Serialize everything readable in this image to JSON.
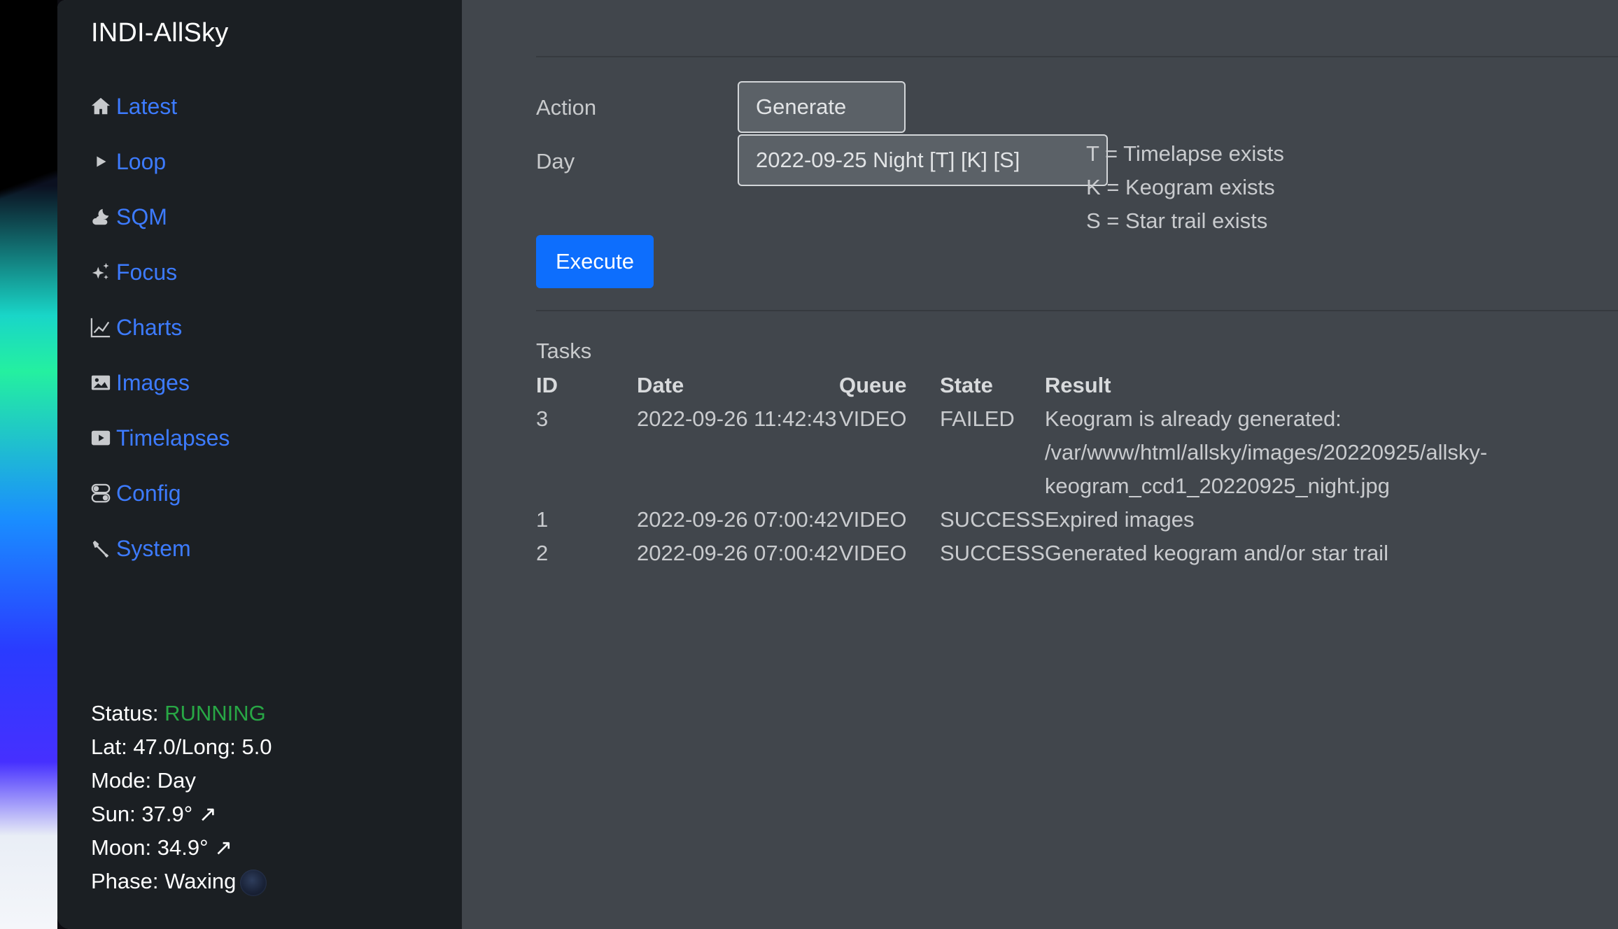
{
  "app": {
    "title": "INDI-AllSky"
  },
  "sidebar": {
    "items": [
      {
        "label": "Latest",
        "icon": "house-icon"
      },
      {
        "label": "Loop",
        "icon": "play-icon"
      },
      {
        "label": "SQM",
        "icon": "cloud-moon-icon"
      },
      {
        "label": "Focus",
        "icon": "sparkles-icon"
      },
      {
        "label": "Charts",
        "icon": "graph-icon"
      },
      {
        "label": "Images",
        "icon": "image-icon"
      },
      {
        "label": "Timelapses",
        "icon": "video-play-icon"
      },
      {
        "label": "Config",
        "icon": "toggles-icon"
      },
      {
        "label": "System",
        "icon": "wrench-icon"
      }
    ],
    "status": {
      "status_label": "Status: ",
      "status_value": "RUNNING",
      "latlong": "Lat: 47.0/Long: 5.0",
      "mode": "Mode: Day",
      "sun": "Sun: 37.9° ↗",
      "moon": "Moon: 34.9° ↗",
      "phase": "Phase: Waxing"
    }
  },
  "form": {
    "action_label": "Action",
    "action_value": "Generate",
    "day_label": "Day",
    "day_value": "2022-09-25 Night [T] [K] [S]",
    "legend": [
      "T = Timelapse exists",
      "K = Keogram exists",
      "S = Star trail exists"
    ],
    "execute_label": "Execute"
  },
  "tasks": {
    "title": "Tasks",
    "headers": {
      "id": "ID",
      "date": "Date",
      "queue": "Queue",
      "state": "State",
      "result": "Result"
    },
    "rows": [
      {
        "id": "3",
        "date": "2022-09-26 11:42:43",
        "queue": "VIDEO",
        "state": "FAILED",
        "result": "Keogram is already generated: /var/www/html/allsky/images/20220925/allsky-keogram_ccd1_20220925_night.jpg"
      },
      {
        "id": "1",
        "date": "2022-09-26 07:00:42",
        "queue": "VIDEO",
        "state": "SUCCESS",
        "result": "Expired images"
      },
      {
        "id": "2",
        "date": "2022-09-26 07:00:42",
        "queue": "VIDEO",
        "state": "SUCCESS",
        "result": "Generated keogram and/or star trail"
      }
    ]
  },
  "colors": {
    "link": "#3d7bff",
    "running": "#28a745",
    "primary_button": "#0d6efd",
    "sidebar_bg": "#1b1f23",
    "main_bg": "#41464c"
  }
}
